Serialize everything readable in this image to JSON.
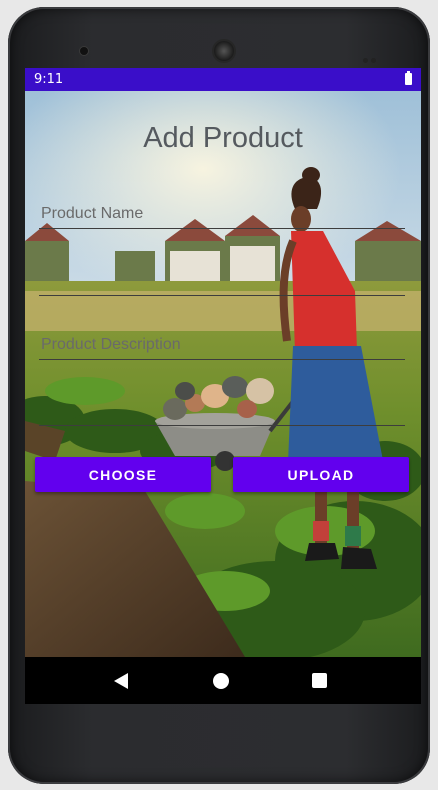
{
  "status_bar": {
    "time": "9:11",
    "color": "#3a0ec9"
  },
  "screen": {
    "title": "Add Product",
    "product_name_placeholder": "Product Name",
    "product_description_placeholder": "Product Description",
    "choose_label": "CHOOSE",
    "upload_label": "UPLOAD",
    "button_color": "#6200ee"
  },
  "nav": {
    "back_icon": "back-triangle",
    "home_icon": "home-circle",
    "recents_icon": "recents-square"
  }
}
